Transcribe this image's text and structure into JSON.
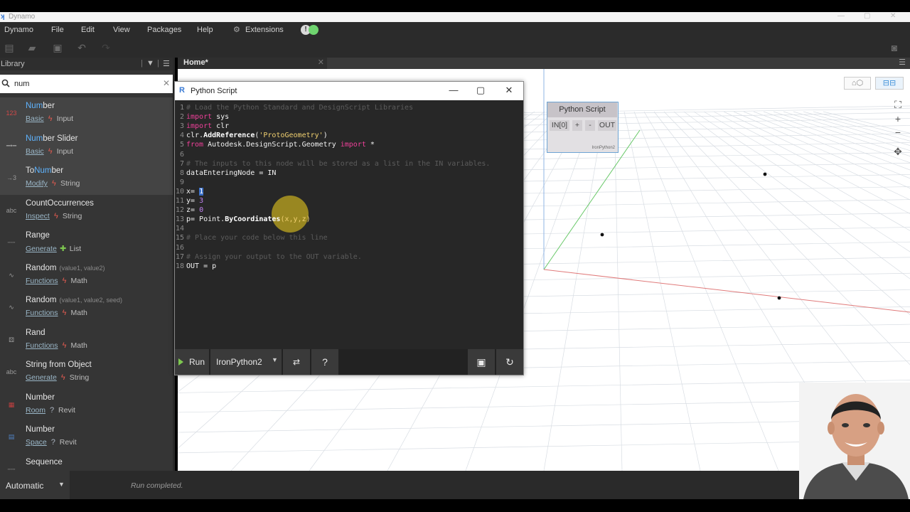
{
  "window": {
    "title": "Dynamo"
  },
  "menu": [
    "Dynamo",
    "File",
    "Edit",
    "View",
    "Packages",
    "Help",
    "Extensions"
  ],
  "status_icon": "!",
  "library": {
    "title": "Library",
    "search_value": "num",
    "items": [
      {
        "pre": "",
        "hl": "Num",
        "post": "ber",
        "params": "",
        "category": "Basic",
        "icon": "bolt",
        "group": "Input",
        "icon_label": "123"
      },
      {
        "pre": "",
        "hl": "Num",
        "post": "ber Slider",
        "params": "",
        "category": "Basic",
        "icon": "bolt",
        "group": "Input",
        "icon_label": "slider"
      },
      {
        "pre": "To",
        "hl": "Num",
        "post": "ber",
        "params": "",
        "category": "Modify",
        "icon": "bolt",
        "group": "String",
        "icon_label": "tonumber"
      },
      {
        "pre": "CountOccurrences",
        "hl": "",
        "post": "",
        "params": "",
        "category": "Inspect",
        "icon": "bolt",
        "group": "String",
        "icon_label": "abc"
      },
      {
        "pre": "Range",
        "hl": "",
        "post": "",
        "params": "",
        "category": "Generate",
        "icon": "plus",
        "group": "List",
        "icon_label": "range"
      },
      {
        "pre": "Random",
        "hl": "",
        "post": "",
        "params": "(value1, value2)",
        "category": "Functions",
        "icon": "bolt",
        "group": "Math",
        "icon_label": "random"
      },
      {
        "pre": "Random",
        "hl": "",
        "post": "",
        "params": "(value1, value2, seed)",
        "category": "Functions",
        "icon": "bolt",
        "group": "Math",
        "icon_label": "random"
      },
      {
        "pre": "Rand",
        "hl": "",
        "post": "",
        "params": "",
        "category": "Functions",
        "icon": "bolt",
        "group": "Math",
        "icon_label": "dice"
      },
      {
        "pre": "String from Object",
        "hl": "",
        "post": "",
        "params": "",
        "category": "Generate",
        "icon": "bolt",
        "group": "String",
        "icon_label": "abc"
      },
      {
        "pre": "Number",
        "hl": "",
        "post": "",
        "params": "",
        "category": "Room",
        "icon": "q",
        "group": "Revit",
        "icon_label": "room"
      },
      {
        "pre": "Number",
        "hl": "",
        "post": "",
        "params": "",
        "category": "Space",
        "icon": "q",
        "group": "Revit",
        "icon_label": "space"
      },
      {
        "pre": "Sequence",
        "hl": "",
        "post": "",
        "params": "",
        "category": "",
        "icon": "",
        "group": "",
        "icon_label": "seq"
      }
    ]
  },
  "tab": {
    "label": "Home*",
    "close": "✕"
  },
  "node": {
    "title": "Python Script",
    "in_port": "IN[0]",
    "add": "+",
    "remove": "-",
    "out_port": "OUT",
    "footer": "IronPython2"
  },
  "editor": {
    "title": "Python Script",
    "lines": [
      [
        [
          "c-cm",
          "# Load the Python Standard and DesignScript Libraries"
        ]
      ],
      [
        [
          "c-kw",
          "import"
        ],
        [
          "c-w",
          " sys"
        ]
      ],
      [
        [
          "c-kw",
          "import"
        ],
        [
          "c-w",
          " clr"
        ]
      ],
      [
        [
          "c-w",
          "clr."
        ],
        [
          "c-bold",
          "AddReference"
        ],
        [
          "c-w",
          "("
        ],
        [
          "c-str",
          "'ProtoGeometry'"
        ],
        [
          "c-w",
          ")"
        ]
      ],
      [
        [
          "c-kw",
          "from"
        ],
        [
          "c-w",
          " Autodesk.DesignScript.Geometry "
        ],
        [
          "c-kw",
          "import"
        ],
        [
          "c-w",
          " *"
        ]
      ],
      [],
      [
        [
          "c-cm",
          "# The inputs to this node will be stored as a list in the IN variables."
        ]
      ],
      [
        [
          "c-w",
          "dataEnteringNode = IN"
        ]
      ],
      [],
      [
        [
          "c-w",
          "x= "
        ],
        [
          "c-num c-sel",
          "1"
        ]
      ],
      [
        [
          "c-w",
          "y= "
        ],
        [
          "c-num",
          "3"
        ]
      ],
      [
        [
          "c-w",
          "z= "
        ],
        [
          "c-num",
          "0"
        ]
      ],
      [
        [
          "c-w",
          "p= Point."
        ],
        [
          "c-bold",
          "ByCoordinates"
        ],
        [
          "c-str",
          "(x,y,z)"
        ]
      ],
      [],
      [
        [
          "c-cm",
          "# Place your code below this line"
        ]
      ],
      [],
      [
        [
          "c-cm",
          "# Assign your output to the OUT variable."
        ]
      ],
      [
        [
          "c-w",
          "OUT = p"
        ]
      ]
    ],
    "run_label": "Run",
    "engine": "IronPython2"
  },
  "status": {
    "run_mode": "Automatic",
    "message": "Run completed."
  }
}
